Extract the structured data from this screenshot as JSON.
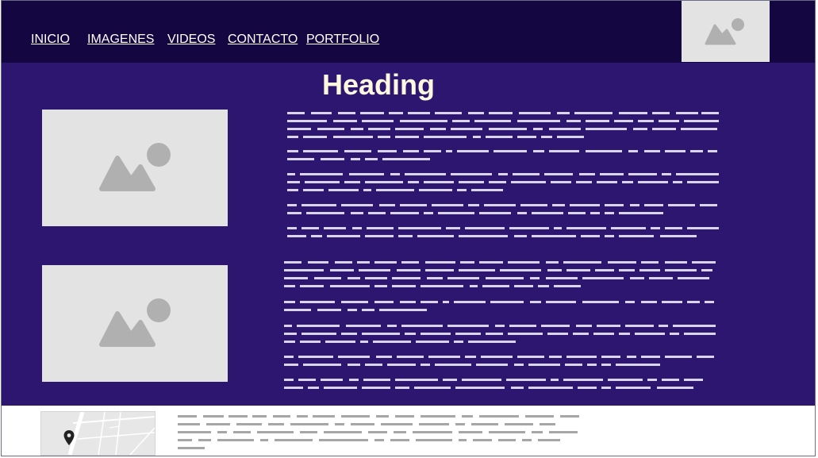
{
  "nav": {
    "items": [
      "INICIO",
      "IMAGENES",
      "VIDEOS",
      "CONTACTO",
      "PORTFOLIO"
    ]
  },
  "header": {
    "logo_icon": "image-placeholder-icon"
  },
  "main": {
    "heading": "Heading",
    "sections": [
      {
        "image_icon": "image-placeholder-icon"
      },
      {
        "image_icon": "image-placeholder-icon"
      }
    ]
  },
  "footer": {
    "map_icon": "map-pin-icon"
  },
  "colors": {
    "header_bg": "#140640",
    "main_bg": "#2d1670",
    "heading": "#fff8de",
    "placeholder": "#e3e3e3",
    "placeholder_icon": "#b0b0b0"
  }
}
